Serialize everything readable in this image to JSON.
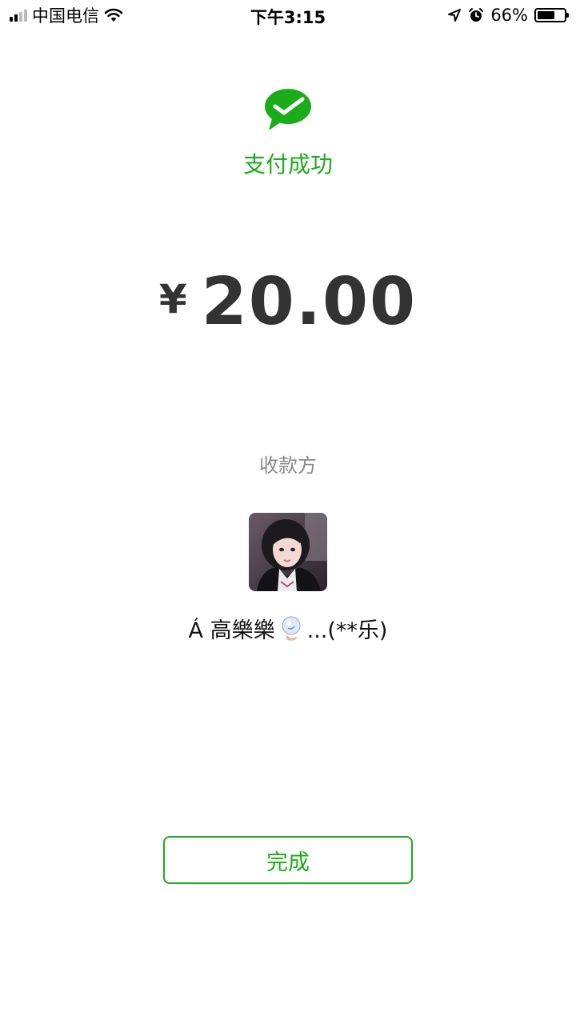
{
  "status_bar": {
    "carrier": "中国电信",
    "time": "下午3:15",
    "battery": "66%",
    "battery_level": 0.66,
    "icons": [
      "signal-icon",
      "wifi-icon",
      "location-arrow-icon",
      "alarm-icon",
      "battery-icon"
    ]
  },
  "result": {
    "title": "支付成功",
    "icon": "wechat-pay-check-icon",
    "accent_color": "#1aad19"
  },
  "amount": {
    "currency_symbol": "¥",
    "value": "20.00"
  },
  "payee": {
    "label": "收款方",
    "name_prefix": "Á  高樂樂",
    "name_suffix": "...(**乐)"
  },
  "actions": {
    "done_label": "完成"
  }
}
